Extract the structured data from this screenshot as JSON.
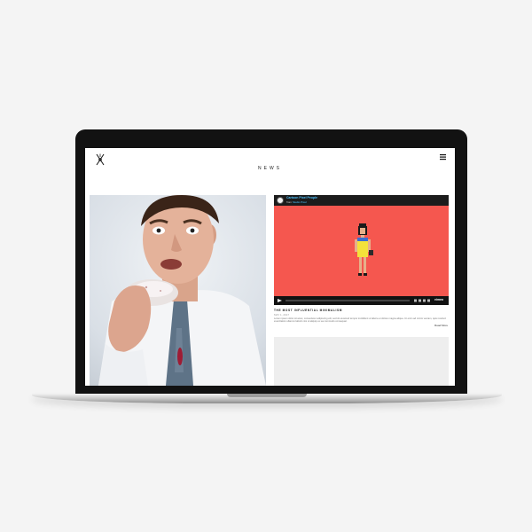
{
  "site": {
    "nav_title": "NEWS"
  },
  "video": {
    "channel_title": "Cartoon Pixel People",
    "by_prefix": "from",
    "author": "Studio Pixel",
    "player_brand": "vimeo"
  },
  "article": {
    "title": "THE MOST INFLUENTIAL MINIMALISM",
    "date": "MAY 1, 2017",
    "body": "Lorem ipsum dolor sit amet, consectetur adipiscing elit, sed do eiusmod tempor incididunt ut labore et dolore magna aliqua. Ut enim ad minim veniam, quis nostrud exercitation ullamco laboris nisi ut aliquip ex ea commodo consequat.",
    "read_more_label": "Read More"
  },
  "icons": {
    "logo": "crossed-needle-logo-icon",
    "menu": "hamburger-menu-icon",
    "play": "play-icon"
  },
  "colors": {
    "video_background": "#f5574f",
    "link_blue": "#4dc3ff",
    "figure_dress": "#f4e23a"
  },
  "player": {
    "progress": 0
  }
}
